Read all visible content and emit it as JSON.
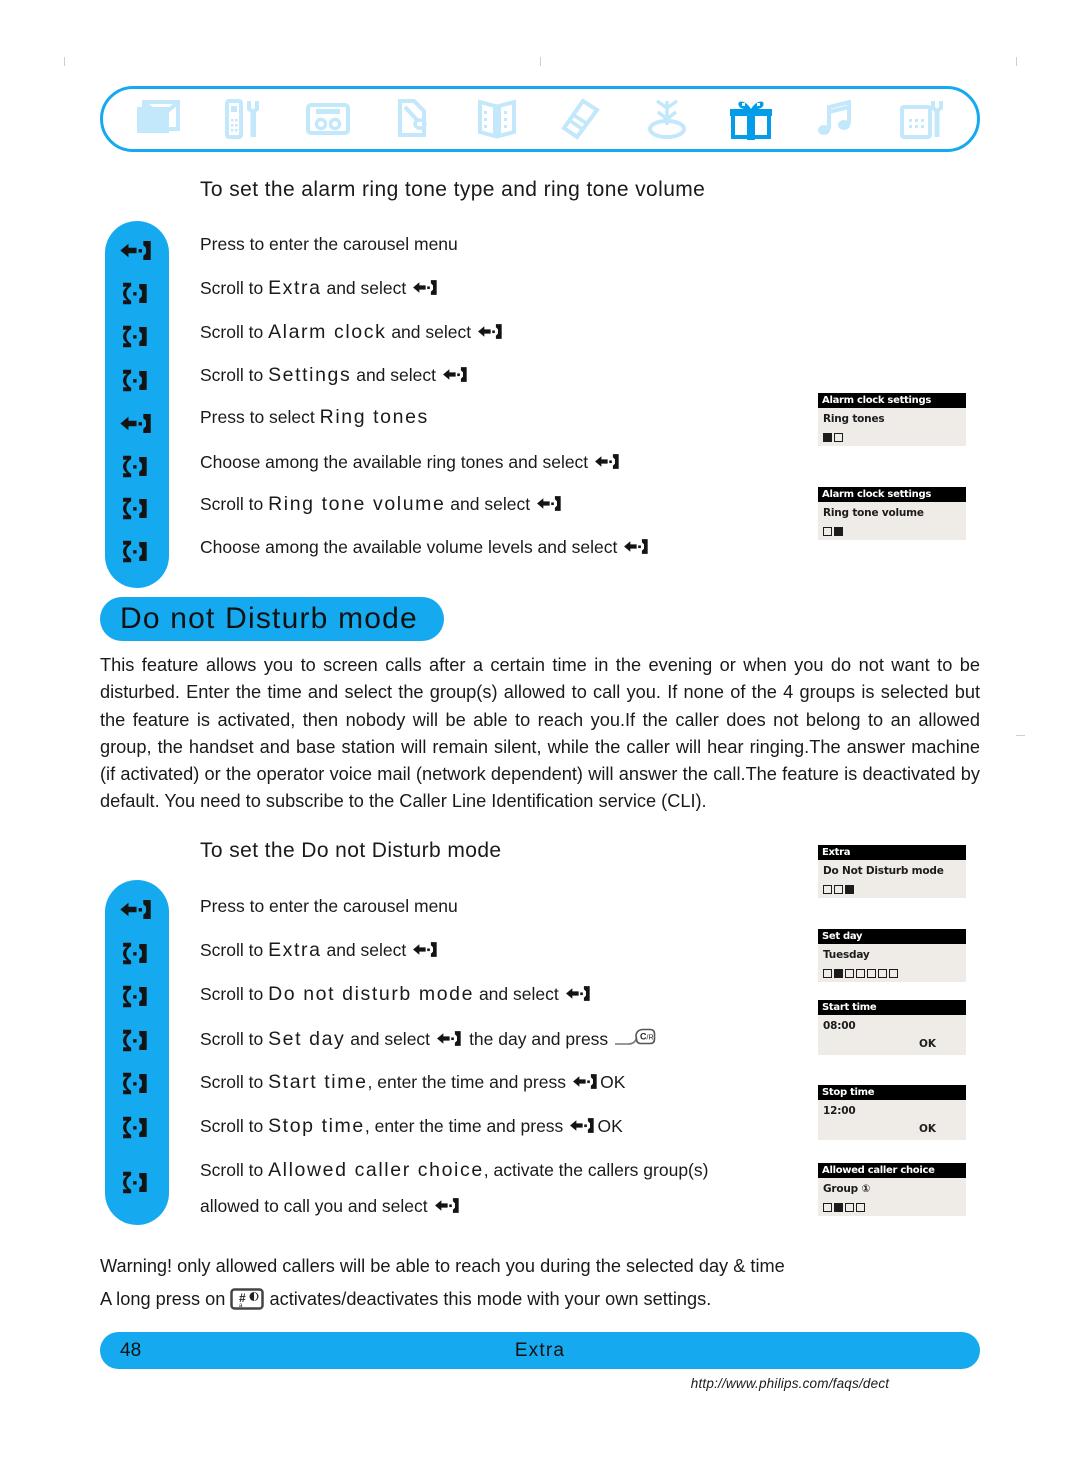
{
  "carousel": {
    "icons": [
      {
        "name": "envelope-icon",
        "label": "Messages"
      },
      {
        "name": "handset-wrench-icon",
        "label": "Settings"
      },
      {
        "name": "answering-machine-icon",
        "label": "Answering machine"
      },
      {
        "name": "handset-pen-icon",
        "label": "Personal settings"
      },
      {
        "name": "open-book-icon",
        "label": "Phonebook"
      },
      {
        "name": "call-list-icon",
        "label": "Calls list"
      },
      {
        "name": "base-antenna-icon",
        "label": "Base station"
      },
      {
        "name": "gift-box-icon",
        "label": "Extra"
      },
      {
        "name": "music-note-icon",
        "label": "Ring tones"
      },
      {
        "name": "fax-base-icon",
        "label": "Base"
      }
    ],
    "active_index": 7
  },
  "section_alarm": {
    "heading": "To set the alarm ring tone type and ring tone volume",
    "steps": [
      {
        "key": "select",
        "parts": [
          {
            "t": "Press to enter the carousel menu",
            "s": "plain"
          }
        ]
      },
      {
        "key": "scroll",
        "parts": [
          {
            "t": "Scroll to ",
            "s": "plain"
          },
          {
            "t": "Extra",
            "s": "term"
          },
          {
            "t": " and select ",
            "s": "plain"
          },
          {
            "t": "select-key",
            "s": "key"
          }
        ]
      },
      {
        "key": "scroll",
        "parts": [
          {
            "t": "Scroll to ",
            "s": "plain"
          },
          {
            "t": "Alarm clock",
            "s": "term"
          },
          {
            "t": " and select ",
            "s": "plain"
          },
          {
            "t": "select-key",
            "s": "key"
          }
        ]
      },
      {
        "key": "scroll",
        "parts": [
          {
            "t": "Scroll to ",
            "s": "plain"
          },
          {
            "t": "Settings",
            "s": "term"
          },
          {
            "t": " and select ",
            "s": "plain"
          },
          {
            "t": "select-key",
            "s": "key"
          }
        ]
      },
      {
        "key": "select",
        "parts": [
          {
            "t": "Press to select ",
            "s": "plain"
          },
          {
            "t": "Ring tones",
            "s": "term"
          }
        ]
      },
      {
        "key": "scroll",
        "parts": [
          {
            "t": "Choose among the available ring tones and select ",
            "s": "plain"
          },
          {
            "t": "select-key",
            "s": "key"
          }
        ]
      },
      {
        "key": "scroll",
        "parts": [
          {
            "t": "Scroll to ",
            "s": "plain"
          },
          {
            "t": "Ring tone volume",
            "s": "term"
          },
          {
            "t": " and select ",
            "s": "plain"
          },
          {
            "t": "select-key",
            "s": "key"
          }
        ]
      },
      {
        "key": "scroll",
        "parts": [
          {
            "t": "Choose among the available volume levels and select ",
            "s": "plain"
          },
          {
            "t": "select-key",
            "s": "key"
          }
        ]
      }
    ],
    "screens": [
      {
        "title": "Alarm clock settings",
        "line": "Ring tones",
        "dots": [
          true,
          false
        ],
        "ok": ""
      },
      {
        "title": "Alarm clock settings",
        "line": "Ring tone volume",
        "dots": [
          false,
          true
        ],
        "ok": ""
      }
    ]
  },
  "dnd": {
    "heading": "Do not Disturb mode",
    "body": "This feature allows you to screen calls after a certain time in the evening or when you do not want to be disturbed. Enter the time and select the group(s) allowed to call you. If none of the 4 groups is selected but the feature is activated, then nobody will be able to reach you.If the caller does not belong to an allowed group, the handset and base station will remain silent, while the caller will hear ringing.The answer machine (if activated) or the operator voice mail (network dependent) will answer the call.The feature is deactivated by default. You need to subscribe to the Caller Line Identification service (CLI).",
    "sub_heading": "To set the Do not Disturb mode",
    "steps": [
      {
        "key": "select",
        "parts": [
          {
            "t": "Press to enter the carousel menu",
            "s": "plain"
          }
        ]
      },
      {
        "key": "scroll",
        "parts": [
          {
            "t": "Scroll to ",
            "s": "plain"
          },
          {
            "t": "Extra",
            "s": "term"
          },
          {
            "t": " and select ",
            "s": "plain"
          },
          {
            "t": "select-key",
            "s": "key"
          }
        ]
      },
      {
        "key": "scroll",
        "parts": [
          {
            "t": "Scroll to ",
            "s": "plain"
          },
          {
            "t": "Do not disturb mode",
            "s": "term"
          },
          {
            "t": " and select ",
            "s": "plain"
          },
          {
            "t": "select-key",
            "s": "key"
          }
        ]
      },
      {
        "key": "scroll",
        "parts": [
          {
            "t": "Scroll to ",
            "s": "plain"
          },
          {
            "t": "Set day",
            "s": "term"
          },
          {
            "t": " and select ",
            "s": "plain"
          },
          {
            "t": "select-key",
            "s": "key"
          },
          {
            "t": " the day and press ",
            "s": "plain"
          },
          {
            "t": "cr-key",
            "s": "key"
          }
        ]
      },
      {
        "key": "scroll",
        "parts": [
          {
            "t": "Scroll to ",
            "s": "plain"
          },
          {
            "t": "Start time",
            "s": "term"
          },
          {
            "t": ", enter the time and press ",
            "s": "plain"
          },
          {
            "t": "select-key",
            "s": "key"
          },
          {
            "t": "OK",
            "s": "plain"
          }
        ]
      },
      {
        "key": "scroll",
        "parts": [
          {
            "t": "Scroll to ",
            "s": "plain"
          },
          {
            "t": "Stop time",
            "s": "term"
          },
          {
            "t": ", enter the time and press ",
            "s": "plain"
          },
          {
            "t": "select-key",
            "s": "key"
          },
          {
            "t": "OK",
            "s": "plain"
          }
        ]
      },
      {
        "key": "scroll",
        "parts": [
          {
            "t": "Scroll to ",
            "s": "plain"
          },
          {
            "t": "Allowed caller choice",
            "s": "term"
          },
          {
            "t": ", activate the callers group(s)",
            "s": "plain"
          }
        ]
      },
      {
        "key": "none",
        "parts": [
          {
            "t": "allowed to call you and select ",
            "s": "plain"
          },
          {
            "t": "select-key",
            "s": "key"
          }
        ]
      }
    ],
    "screens": [
      {
        "title": "Extra",
        "line": "Do Not Disturb mode",
        "dots": [
          false,
          false,
          true
        ],
        "ok": ""
      },
      {
        "title": "Set day",
        "line": "Tuesday",
        "dots": [
          false,
          true,
          false,
          false,
          false,
          false,
          false
        ],
        "ok": ""
      },
      {
        "title": "Start time",
        "line": "08:00",
        "dots": [],
        "ok": "OK"
      },
      {
        "title": "Stop time",
        "line": "12:00",
        "dots": [],
        "ok": "OK"
      },
      {
        "title": "Allowed caller choice",
        "line": "Group ①",
        "dots": [
          false,
          true,
          false,
          false
        ],
        "ok": ""
      }
    ]
  },
  "notes": {
    "warning": "Warning! only allowed callers will be able to reach you during the selected day & time",
    "long_press_before": "A long press on ",
    "long_press_after": " activates/deactivates this mode with your own settings."
  },
  "footer": {
    "page_number": "48",
    "section_label": "Extra",
    "url": "http://www.philips.com/faqs/dect"
  },
  "colors": {
    "accent_blue": "#15a9ef",
    "icon_pale_blue": "#c3e7fb",
    "lcd_bg": "#efece8",
    "text": "#1a1a1a"
  }
}
